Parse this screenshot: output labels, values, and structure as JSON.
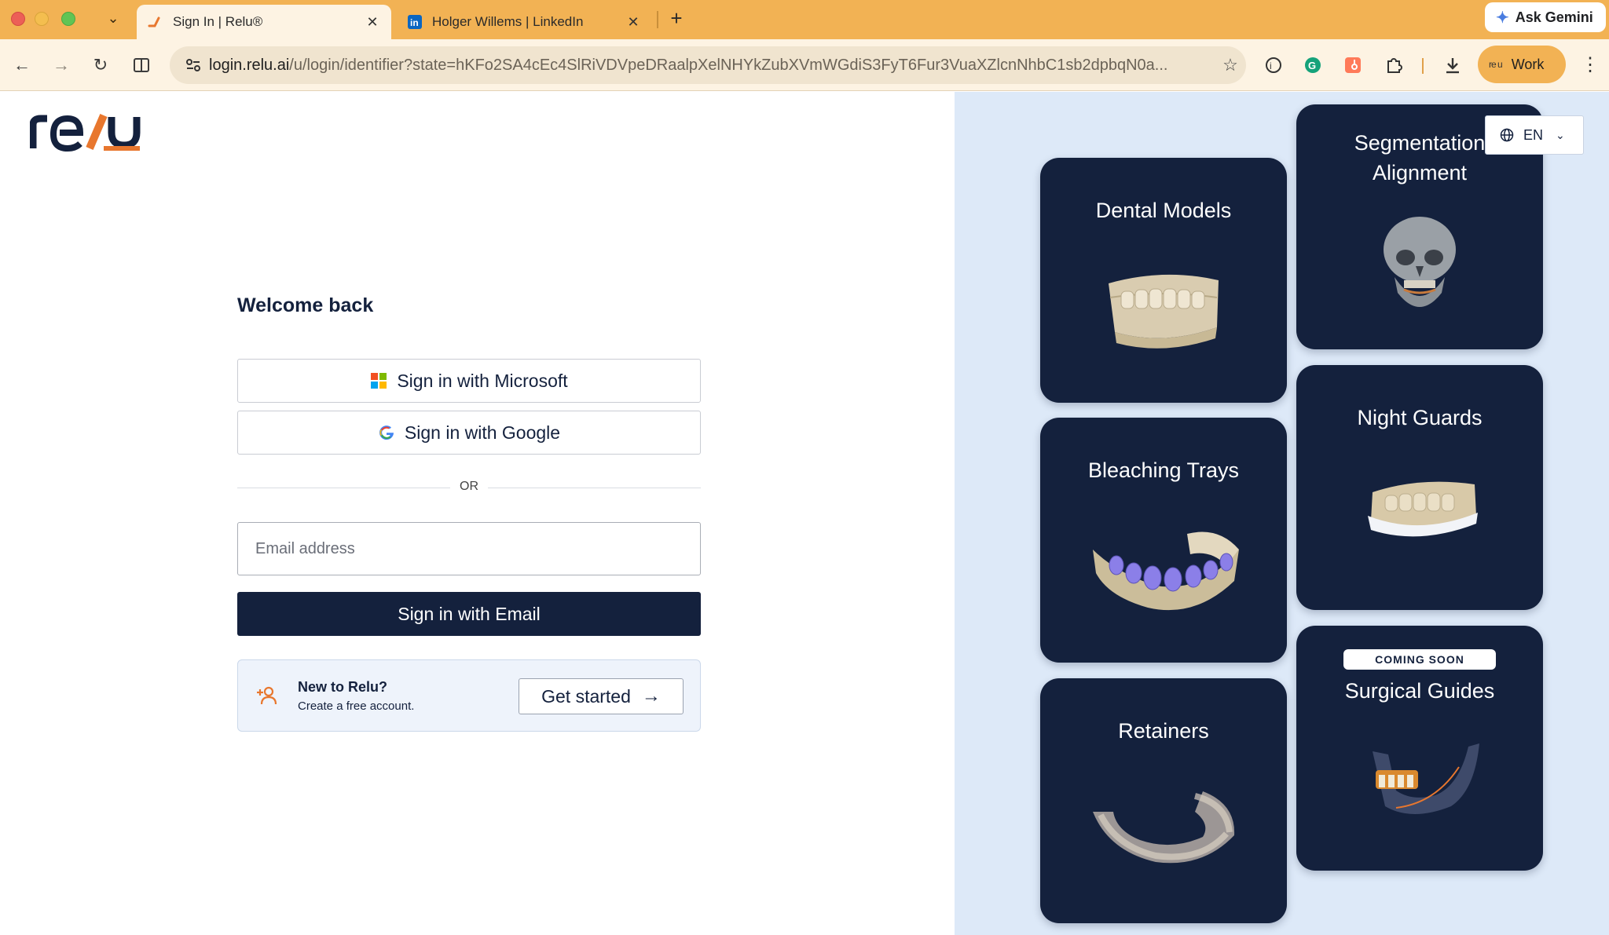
{
  "browser": {
    "tabs": [
      {
        "title": "Sign In | Relu®",
        "active": true
      },
      {
        "title": "Holger Willems | LinkedIn",
        "active": false
      }
    ],
    "new_tab": "+",
    "ask_gemini": "Ask Gemini",
    "url": {
      "host": "login.relu.ai",
      "path": "/u/login/identifier?state=hKFo2SA4cEc4SlRiVDVpeDRaalpXelNHYkZubXVmWGdiS3FyT6Fur3VuaXZlcnNhbC1sb2dpbqN0a..."
    },
    "profile": {
      "mini": "re u",
      "label": "Work"
    },
    "icons": [
      "back-icon",
      "forward-icon",
      "reload-icon",
      "split-view-icon",
      "site-settings-icon",
      "star-icon",
      "extension-icon",
      "grammarly-icon",
      "hubspot-icon",
      "puzzle-icon",
      "download-icon",
      "more-icon"
    ]
  },
  "login": {
    "heading": "Welcome back",
    "microsoft_label": "Sign in with Microsoft",
    "google_label": "Sign in with Google",
    "or_label": "OR",
    "email_placeholder": "Email address",
    "email_value": "",
    "email_button": "Sign in with Email",
    "signup": {
      "title": "New to Relu?",
      "subtitle": "Create a free account.",
      "button": "Get started"
    }
  },
  "language": {
    "selected": "EN"
  },
  "products": [
    {
      "title": "Dental Models"
    },
    {
      "title": "Segmentation Alignment",
      "title_lines": [
        "Segmentation",
        "Alignment"
      ]
    },
    {
      "title": "Bleaching Trays"
    },
    {
      "title": "Night Guards"
    },
    {
      "title": "Retainers"
    },
    {
      "title": "Surgical Guides",
      "badge": "COMING SOON"
    }
  ],
  "colors": {
    "brand_navy": "#14213d",
    "brand_orange": "#e8772e",
    "panel_bg": "#dde9f8",
    "browser_accent": "#f2b254"
  }
}
